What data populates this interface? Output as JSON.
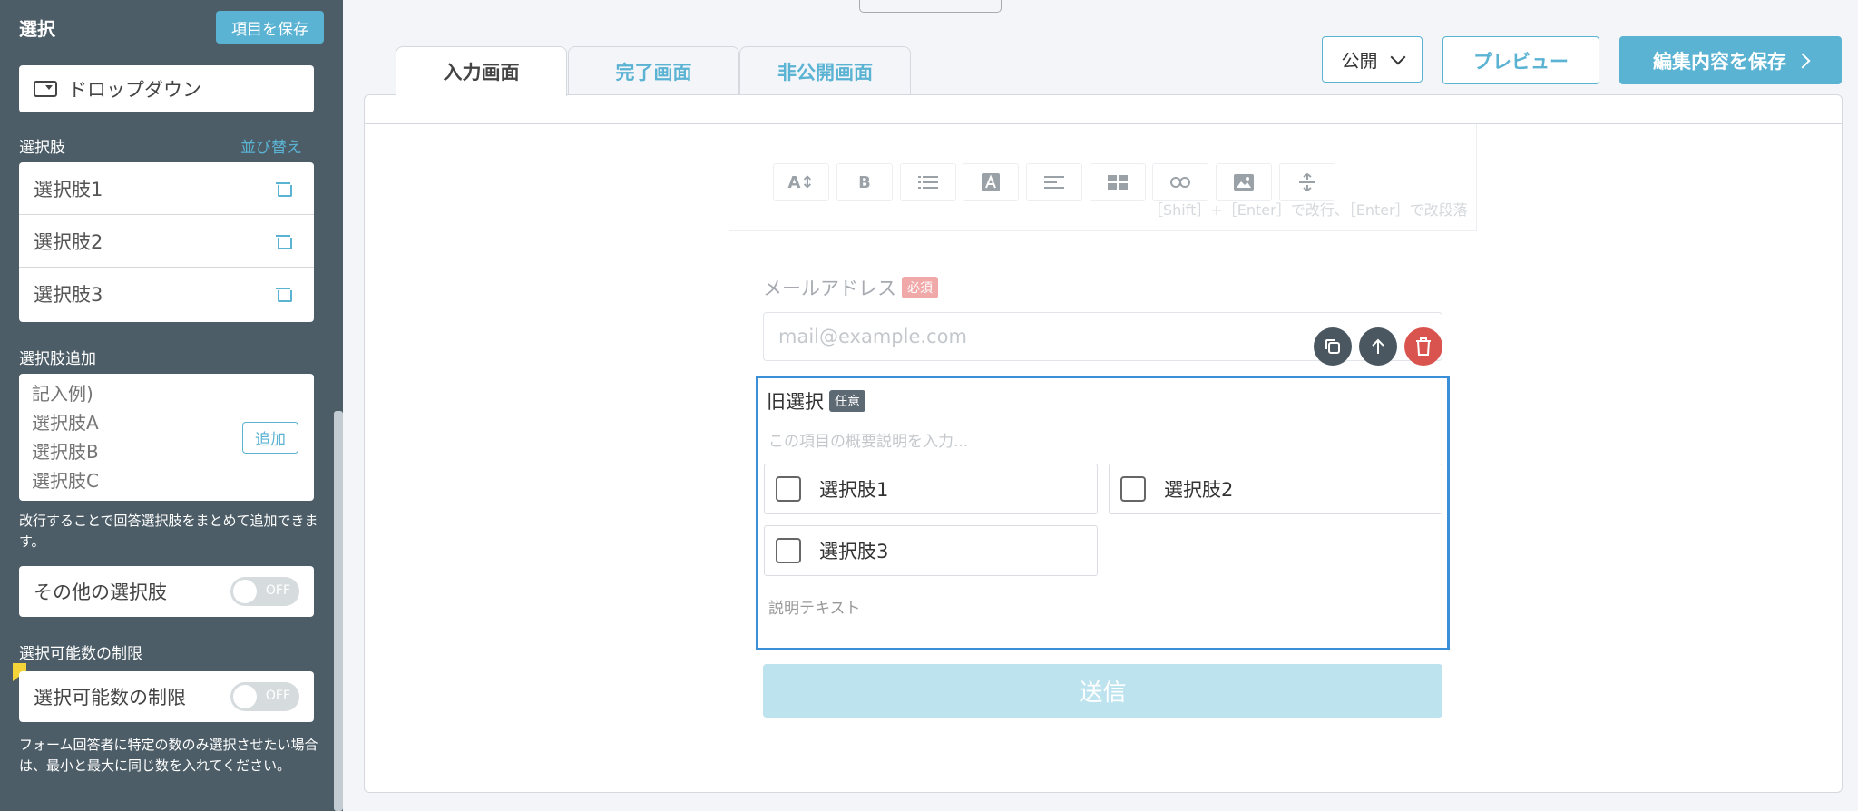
{
  "sidebar": {
    "title": "選択",
    "save_label": "項目を保存",
    "type_label": "ドロップダウン",
    "options_label": "選択肢",
    "sort_label": "並び替え",
    "options": [
      {
        "label": "選択肢1"
      },
      {
        "label": "選択肢2"
      },
      {
        "label": "選択肢3"
      }
    ],
    "add_section_label": "選択肢追加",
    "add_placeholder": "記入例)\n選択肢A\n選択肢B\n選択肢C",
    "add_button": "追加",
    "add_note": "改行することで回答選択肢をまとめて追加できます。",
    "other_option_label": "その他の選択肢",
    "other_option_toggle": "OFF",
    "limit_section_label": "選択可能数の制限",
    "limit_label": "選択可能数の制限",
    "limit_toggle": "OFF",
    "limit_note": "フォーム回答者に特定の数のみ選択させたい場合は、最小と最大に同じ数を入れてください。"
  },
  "tabs": [
    {
      "label": "入力画面",
      "active": true
    },
    {
      "label": "完了画面",
      "active": false
    },
    {
      "label": "非公開画面",
      "active": false
    }
  ],
  "header": {
    "publish_label": "公開",
    "preview_label": "プレビュー",
    "save_label": "編集内容を保存"
  },
  "editor": {
    "toolbar_hint": "［Shift］+［Enter］で改行、［Enter］で改段落",
    "toolbar_icons": [
      "font-size-icon",
      "bold-icon",
      "list-icon",
      "text-color-icon",
      "align-icon",
      "table-icon",
      "link-icon",
      "image-icon",
      "divider-icon"
    ],
    "bold_glyph": "B",
    "font_size_glyph": "A↕",
    "email_label": "メールアドレス",
    "required_badge": "必須",
    "email_placeholder": "mail@example.com",
    "select_title": "旧選択",
    "optional_badge": "任意",
    "select_desc_placeholder": "この項目の概要説明を入力...",
    "choices": [
      {
        "label": "選択肢1"
      },
      {
        "label": "選択肢2"
      },
      {
        "label": "選択肢3"
      }
    ],
    "help_text": "説明テキスト",
    "submit_label": "送信"
  },
  "colors": {
    "sidebar_bg": "#4c5d67",
    "accent": "#5bb3d3",
    "selected_border": "#3a8fd6",
    "delete_red": "#d9534f",
    "submit_disabled": "#bde3ee"
  }
}
